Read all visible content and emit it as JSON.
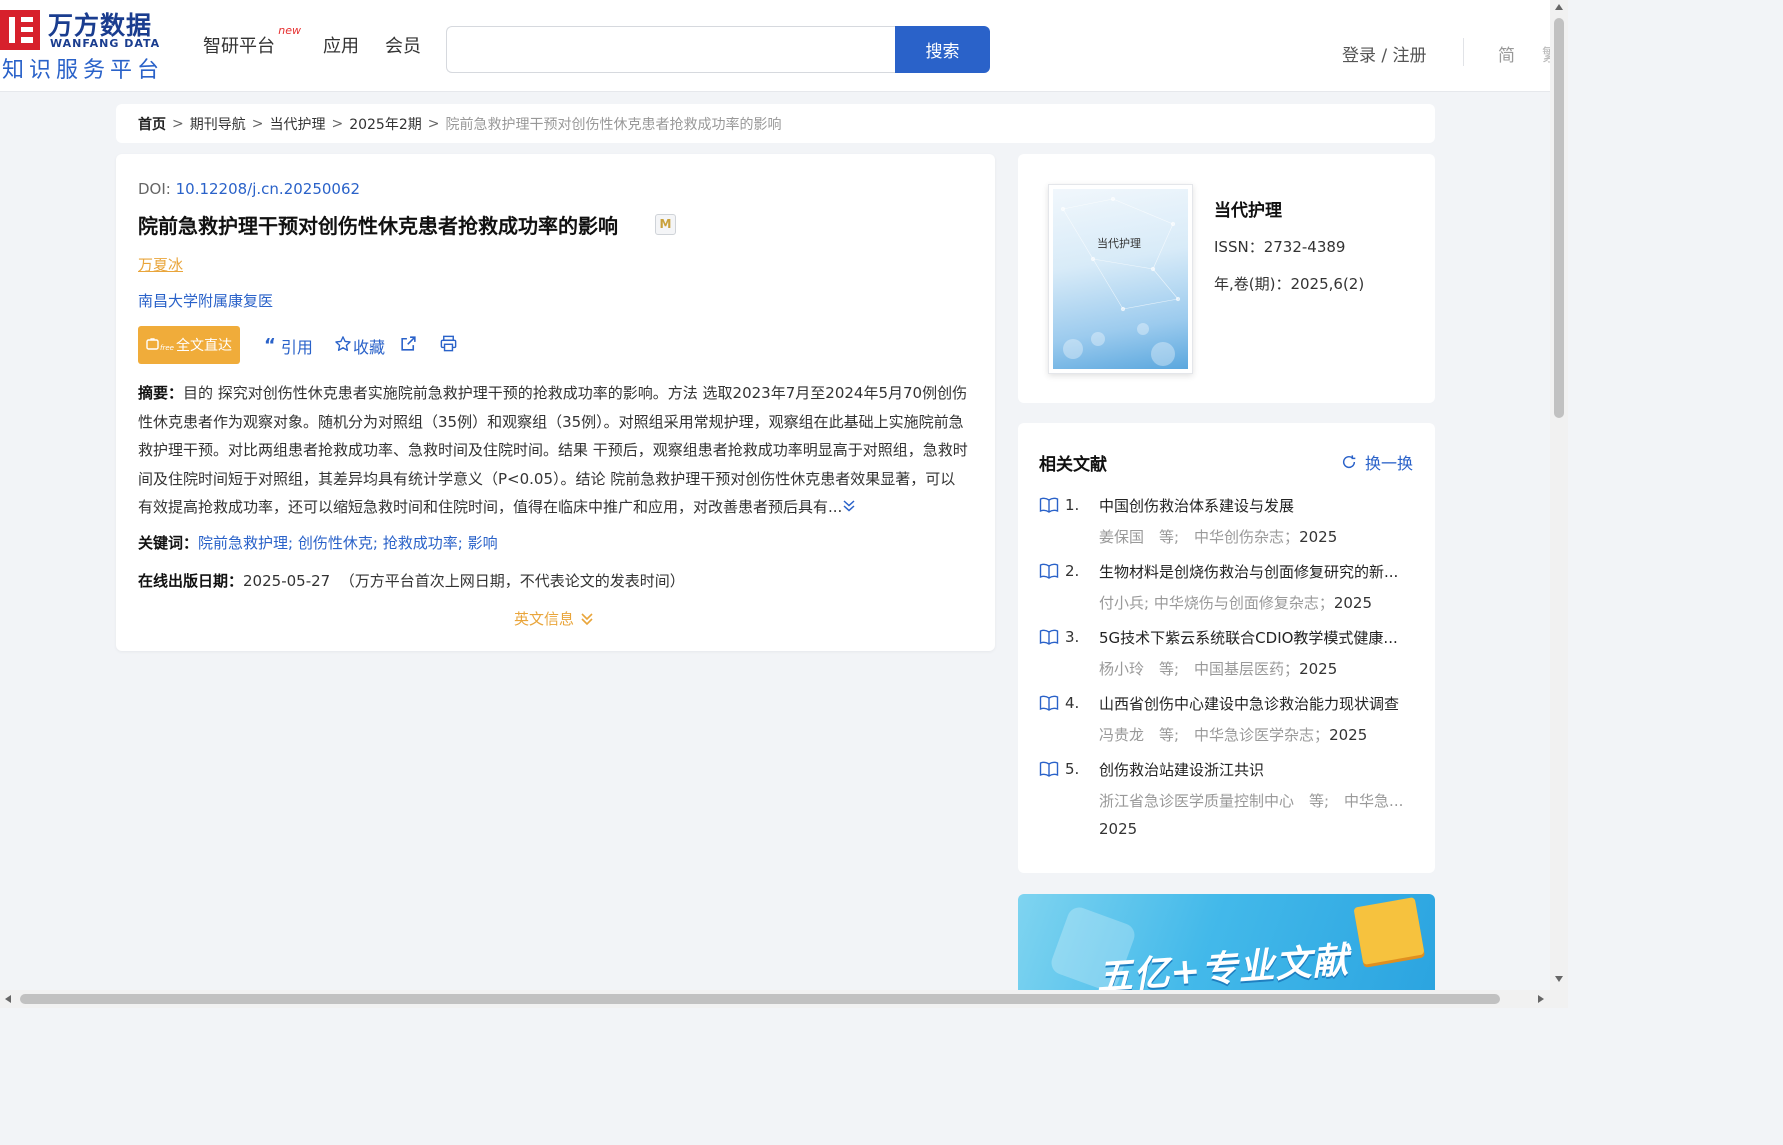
{
  "header": {
    "logo_cn": "万方数据",
    "logo_en": "WANFANG DATA",
    "logo_sub": "知识服务平台",
    "nav": [
      {
        "label": "智研平台",
        "badge": "new"
      },
      {
        "label": "应用"
      },
      {
        "label": "会员"
      }
    ],
    "search_value": "",
    "search_button": "搜索",
    "login": "登录 / 注册",
    "lang_simplified": "简",
    "lang_traditional": "繁"
  },
  "breadcrumb": {
    "home": "首页",
    "sep": ">",
    "items": [
      "期刊导航",
      "当代护理",
      "2025年2期"
    ],
    "current": "院前急救护理干预对创伤性休克患者抢救成功率的影响"
  },
  "article": {
    "doi_label": "DOI: ",
    "doi": "10.12208/j.cn.20250062",
    "title": "院前急救护理干预对创伤性休克患者抢救成功率的影响",
    "m_badge": "M",
    "author": "万夏冰",
    "organization": "南昌大学附属康复医",
    "fulltext_button": "全文直达",
    "fulltext_icon_text": "free",
    "actions": {
      "cite": "引用",
      "favorite": "收藏"
    },
    "abstract_label": "摘要：",
    "abstract_text": "目的 探究对创伤性休克患者实施院前急救护理干预的抢救成功率的影响。方法 选取2023年7月至2024年5月70例创伤性休克患者作为观察对象。随机分为对照组（35例）和观察组（35例）。对照组采用常规护理，观察组在此基础上实施院前急救护理干预。对比两组患者抢救成功率、急救时间及住院时间。结果 干预后，观察组患者抢救成功率明显高于对照组，急救时间及住院时间短于对照组，其差异均具有统计学意义（P<0.05）。结论 院前急救护理干预对创伤性休克患者效果显著，可以有效提高抢救成功率，还可以缩短急救时间和住院时间，值得在临床中推广和应用，对改善患者预后具有...",
    "keywords_label": "关键词：",
    "keywords": [
      "院前急救护理",
      "创伤性休克",
      "抢救成功率",
      "影响"
    ],
    "keyword_sep": ";",
    "pubdate_label": "在线出版日期：",
    "pubdate": "2025-05-27",
    "pubdate_note": "（万方平台首次上网日期，不代表论文的发表时间）",
    "english_info": "英文信息"
  },
  "journal": {
    "cover_title": "当代护理",
    "name": "当代护理",
    "issn": "ISSN：2732-4389",
    "volume": "年,卷(期)：2025,6(2)"
  },
  "related": {
    "title": "相关文献",
    "refresh": "换一换",
    "items": [
      {
        "num": "1.",
        "title": "中国创伤救治体系建设与发展",
        "meta": "姜保国　等;　中华创伤杂志；",
        "year": "2025"
      },
      {
        "num": "2.",
        "title": "生物材料是创烧伤救治与创面修复研究的新...",
        "meta": "付小兵; 中华烧伤与创面修复杂志；",
        "year": "2025"
      },
      {
        "num": "3.",
        "title": "5G技术下紫云系统联合CDIO教学模式健康...",
        "meta": "杨小玲　等;　中国基层医药；",
        "year": "2025"
      },
      {
        "num": "4.",
        "title": "山西省创伤中心建设中急诊救治能力现状调查",
        "meta": "冯贵龙　等;　中华急诊医学杂志；",
        "year": "2025"
      },
      {
        "num": "5.",
        "title": "创伤救治站建设浙江共识",
        "meta": "浙江省急诊医学质量控制中心　等;　中华急...",
        "year": "2025"
      }
    ]
  },
  "banner": {
    "text": "五亿+专业文献"
  },
  "colors": {
    "brand_blue": "#2a62c9",
    "accent_orange": "#f0ac3a",
    "logo_red": "#d7202c"
  }
}
